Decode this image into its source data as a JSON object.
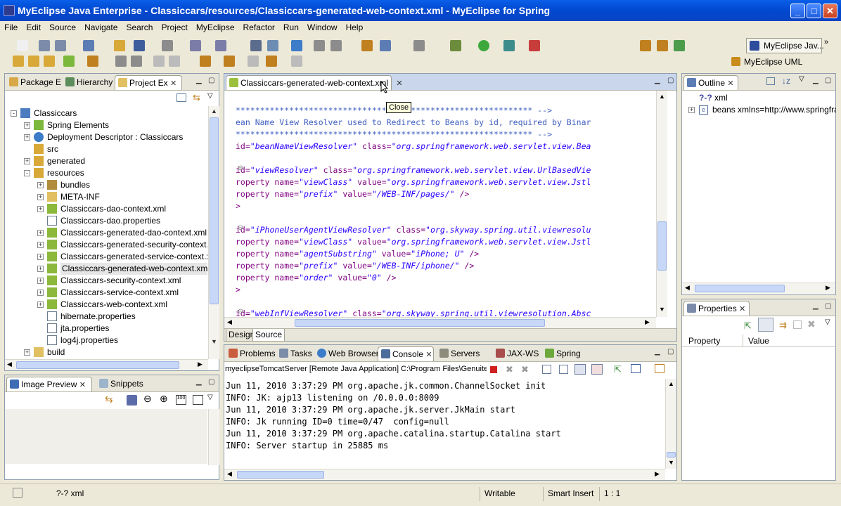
{
  "window": {
    "title": "MyEclipse Java Enterprise - Classiccars/resources/Classiccars-generated-web-context.xml - MyEclipse for Spring",
    "min": "_",
    "max": "□",
    "close": "✕"
  },
  "menu": [
    "File",
    "Edit",
    "Source",
    "Navigate",
    "Search",
    "Project",
    "MyEclipse",
    "Refactor",
    "Run",
    "Window",
    "Help"
  ],
  "perspectives": {
    "java": "MyEclipse Jav...",
    "uml": "MyEclipse UML"
  },
  "left_tabs": [
    "Package E",
    "Hierarchy",
    "Project Ex"
  ],
  "tree": [
    {
      "label": "Classiccars",
      "depth": 0,
      "exp": "-",
      "icon": "project"
    },
    {
      "label": "Spring Elements",
      "depth": 1,
      "exp": "+",
      "icon": "spring"
    },
    {
      "label": "Deployment Descriptor : Classiccars",
      "depth": 1,
      "exp": "+",
      "icon": "globe"
    },
    {
      "label": "src",
      "depth": 1,
      "exp": "",
      "icon": "srcfolder"
    },
    {
      "label": "generated",
      "depth": 1,
      "exp": "+",
      "icon": "srcfolder"
    },
    {
      "label": "resources",
      "depth": 1,
      "exp": "-",
      "icon": "srcfolder"
    },
    {
      "label": "bundles",
      "depth": 2,
      "exp": "+",
      "icon": "package"
    },
    {
      "label": "META-INF",
      "depth": 2,
      "exp": "+",
      "icon": "folder"
    },
    {
      "label": "Classiccars-dao-context.xml",
      "depth": 2,
      "exp": "+",
      "icon": "springxml"
    },
    {
      "label": "Classiccars-dao.properties",
      "depth": 2,
      "exp": "",
      "icon": "props"
    },
    {
      "label": "Classiccars-generated-dao-context.xml",
      "depth": 2,
      "exp": "+",
      "icon": "springxml"
    },
    {
      "label": "Classiccars-generated-security-context.xm",
      "depth": 2,
      "exp": "+",
      "icon": "springxml"
    },
    {
      "label": "Classiccars-generated-service-context.xml",
      "depth": 2,
      "exp": "+",
      "icon": "springxml"
    },
    {
      "label": "Classiccars-generated-web-context.xml",
      "depth": 2,
      "exp": "+",
      "icon": "springxml",
      "selected": true
    },
    {
      "label": "Classiccars-security-context.xml",
      "depth": 2,
      "exp": "+",
      "icon": "springxml"
    },
    {
      "label": "Classiccars-service-context.xml",
      "depth": 2,
      "exp": "+",
      "icon": "springxml"
    },
    {
      "label": "Classiccars-web-context.xml",
      "depth": 2,
      "exp": "+",
      "icon": "springxml"
    },
    {
      "label": "hibernate.properties",
      "depth": 2,
      "exp": "",
      "icon": "props"
    },
    {
      "label": "jta.properties",
      "depth": 2,
      "exp": "",
      "icon": "props"
    },
    {
      "label": "log4j.properties",
      "depth": 2,
      "exp": "",
      "icon": "props"
    },
    {
      "label": "build",
      "depth": 1,
      "exp": "+",
      "icon": "folder"
    }
  ],
  "preview_tabs": [
    "Image Preview",
    "Snippets"
  ],
  "editor": {
    "tab": "Classiccars-generated-web-context.xml",
    "tooltip": "Close",
    "bottom_tabs": [
      "Design",
      "Source"
    ],
    "lines": [
      [
        [
          "cm",
          "************************************************************* -->"
        ]
      ],
      [
        [
          "cm",
          "ean Name View Resolver used to Redirect to Beans by id, required by Binar"
        ]
      ],
      [
        [
          "cm",
          "************************************************************* -->"
        ]
      ],
      [
        [
          "at",
          "id="
        ],
        [
          "av",
          "\"beanNameViewResolver\""
        ],
        [
          "at",
          " class="
        ],
        [
          "av",
          "\"org.springframework.web.servlet.view.Bea"
        ]
      ],
      [
        [
          "at",
          ""
        ]
      ],
      [
        [
          "at",
          "id="
        ],
        [
          "av",
          "\"viewResolver\""
        ],
        [
          "at",
          " class="
        ],
        [
          "av",
          "\"org.springframework.web.servlet.view.UrlBasedVie"
        ]
      ],
      [
        [
          "at",
          "roperty name="
        ],
        [
          "av",
          "\"viewClass\""
        ],
        [
          "at",
          " value="
        ],
        [
          "av",
          "\"org.springframework.web.servlet.view.Jstl"
        ]
      ],
      [
        [
          "at",
          "roperty name="
        ],
        [
          "av",
          "\"prefix\""
        ],
        [
          "at",
          " value="
        ],
        [
          "av",
          "\"/WEB-INF/pages/\""
        ],
        [
          "at",
          " />"
        ]
      ],
      [
        [
          "at",
          ">"
        ]
      ],
      [
        [
          "at",
          ""
        ]
      ],
      [
        [
          "at",
          "id="
        ],
        [
          "av",
          "\"iPhoneUserAgentViewResolver\""
        ],
        [
          "at",
          " class="
        ],
        [
          "av",
          "\"org.skyway.spring.util.viewresolu"
        ]
      ],
      [
        [
          "at",
          "roperty name="
        ],
        [
          "av",
          "\"viewClass\""
        ],
        [
          "at",
          " value="
        ],
        [
          "av",
          "\"org.springframework.web.servlet.view.Jstl"
        ]
      ],
      [
        [
          "at",
          "roperty name="
        ],
        [
          "av",
          "\"agentSubstring\""
        ],
        [
          "at",
          " value="
        ],
        [
          "av",
          "\"iPhone; U\""
        ],
        [
          "at",
          " />"
        ]
      ],
      [
        [
          "at",
          "roperty name="
        ],
        [
          "av",
          "\"prefix\""
        ],
        [
          "at",
          " value="
        ],
        [
          "av",
          "\"/WEB-INF/iphone/\""
        ],
        [
          "at",
          " />"
        ]
      ],
      [
        [
          "at",
          "roperty name="
        ],
        [
          "av",
          "\"order\""
        ],
        [
          "at",
          " value="
        ],
        [
          "av",
          "\"0\""
        ],
        [
          "at",
          " />"
        ]
      ],
      [
        [
          "at",
          ">"
        ]
      ],
      [
        [
          "at",
          ""
        ]
      ],
      [
        [
          "at",
          "id="
        ],
        [
          "av",
          "\"webInfViewResolver\""
        ],
        [
          "at",
          " class="
        ],
        [
          "av",
          "\"org.skyway.spring.util.viewresolution.Absc"
        ]
      ]
    ]
  },
  "outline": {
    "tab": "Outline",
    "items": [
      "xml",
      "beans xmlns=http://www.springfrar"
    ],
    "item0_prefix": "?-?"
  },
  "properties": {
    "tab": "Properties",
    "col_property": "Property",
    "col_value": "Value"
  },
  "console_tabs": [
    "Problems",
    "Tasks",
    "Web Browser",
    "Console",
    "Servers",
    "JAX-WS",
    "Spring"
  ],
  "console": {
    "header": "myeclipseTomcatServer [Remote Java Application] C:\\Program Files\\Genuitec",
    "lines": [
      "Jun 11, 2010 3:37:29 PM org.apache.jk.common.ChannelSocket init",
      "INFO: JK: ajp13 listening on /0.0.0.0:8009",
      "Jun 11, 2010 3:37:29 PM org.apache.jk.server.JkMain start",
      "INFO: Jk running ID=0 time=0/47  config=null",
      "Jun 11, 2010 3:37:29 PM org.apache.catalina.startup.Catalina start",
      "INFO: Server startup in 25885 ms"
    ]
  },
  "status": {
    "left": "?-? xml",
    "writable": "Writable",
    "insert": "Smart Insert",
    "pos": "1 : 1"
  }
}
